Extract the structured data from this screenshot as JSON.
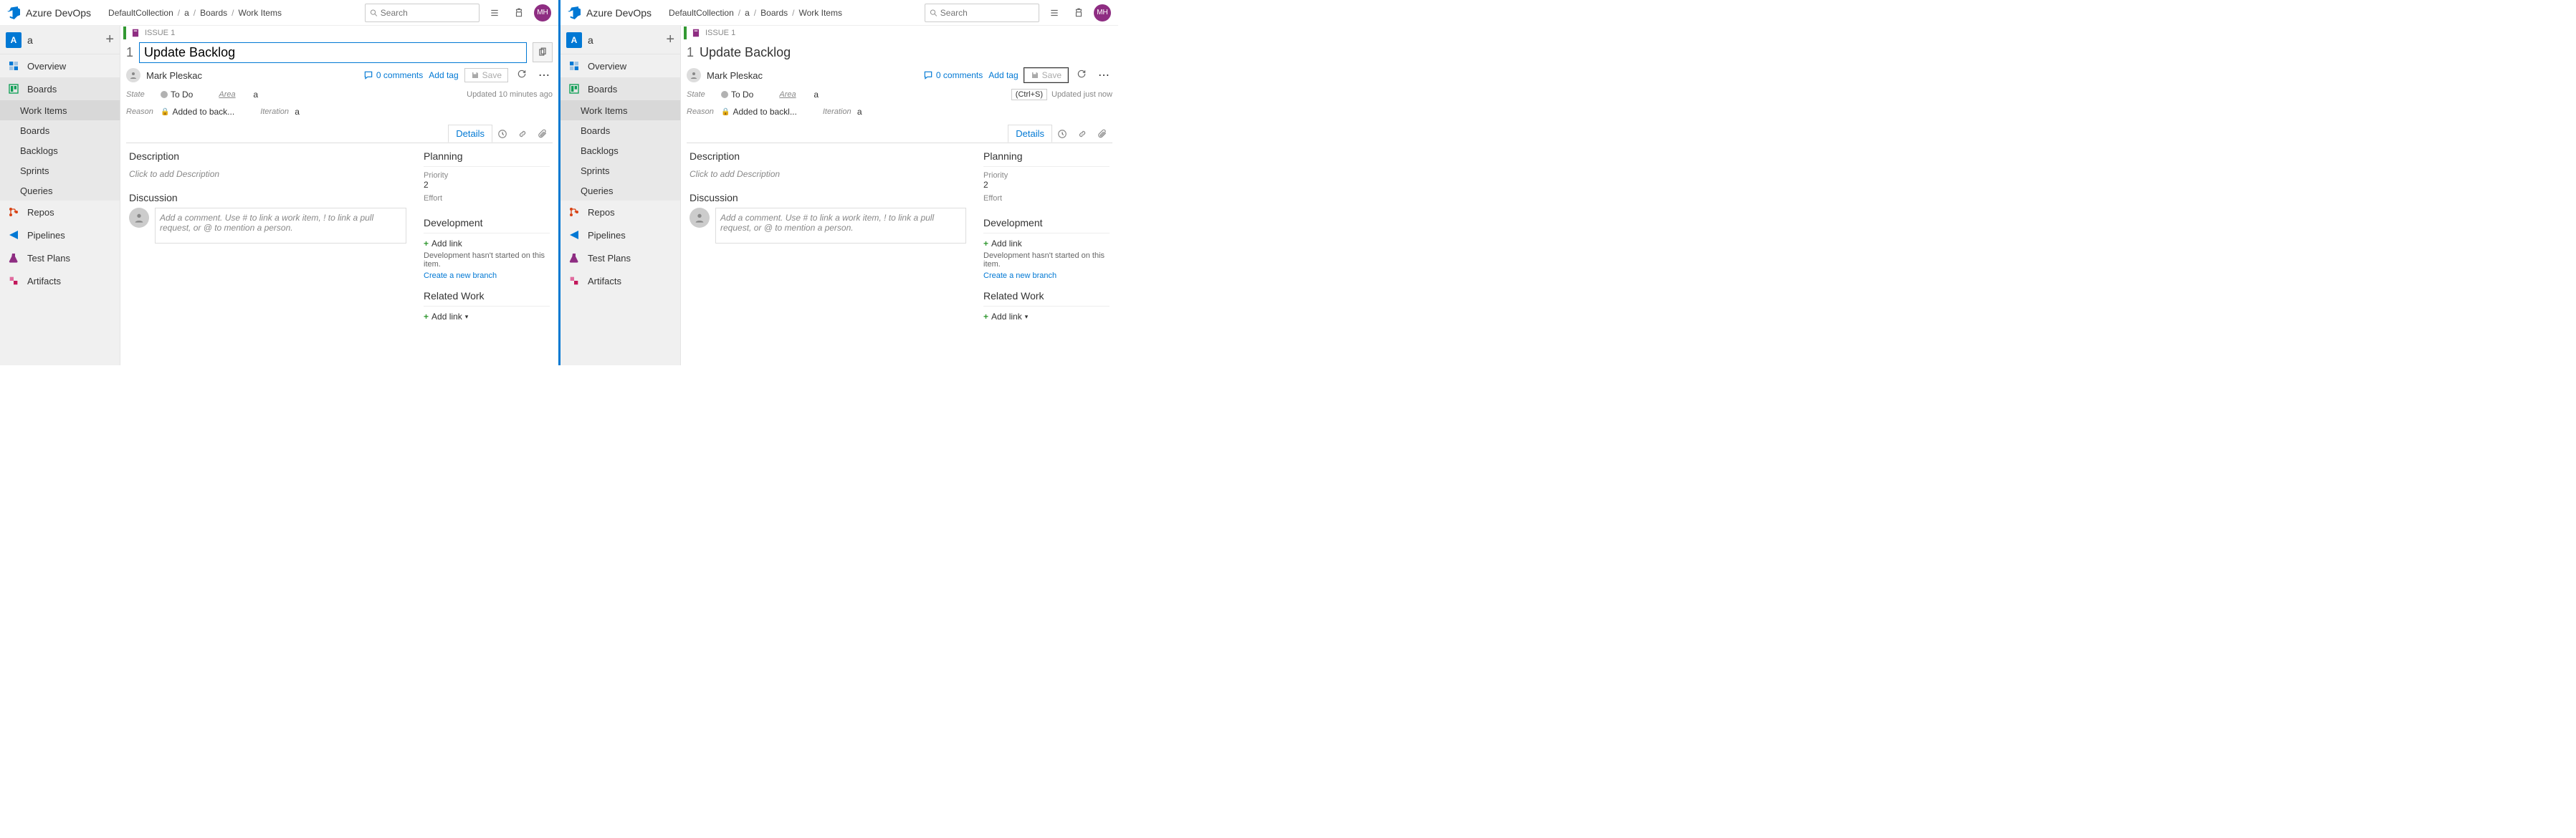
{
  "brand": "Azure DevOps",
  "breadcrumb": [
    "DefaultCollection",
    "a",
    "Boards",
    "Work Items"
  ],
  "search_placeholder": "Search",
  "avatar_initials": "MH",
  "project": {
    "badge": "A",
    "name": "a"
  },
  "nav": {
    "overview": "Overview",
    "boards": "Boards",
    "boards_children": [
      "Work Items",
      "Boards",
      "Backlogs",
      "Sprints",
      "Queries"
    ],
    "repos": "Repos",
    "pipelines": "Pipelines",
    "testplans": "Test Plans",
    "artifacts": "Artifacts"
  },
  "work_item": {
    "issue_label": "ISSUE 1",
    "id": "1",
    "title": "Update Backlog",
    "assignee": "Mark Pleskac",
    "comments": "0 comments",
    "add_tag": "Add tag",
    "save": "Save",
    "state_label": "State",
    "state_value": "To Do",
    "area_label": "Area",
    "area_value": "a",
    "reason_label": "Reason",
    "reason_value_left": "Added to back...",
    "reason_value_right": "Added to backl...",
    "iteration_label": "Iteration",
    "iteration_value": "a",
    "updated_left": "Updated 10 minutes ago",
    "updated_right": "Updated just now",
    "save_tooltip": "(Ctrl+S)"
  },
  "tabs": {
    "details": "Details"
  },
  "sections": {
    "description": "Description",
    "description_ph": "Click to add Description",
    "discussion": "Discussion",
    "discussion_ph": "Add a comment. Use # to link a work item, ! to link a pull request, or @ to mention a person.",
    "planning": "Planning",
    "priority_label": "Priority",
    "priority_value": "2",
    "effort_label": "Effort",
    "development": "Development",
    "addlink": "Add link",
    "dev_note": "Development hasn't started on this item.",
    "new_branch": "Create a new branch",
    "related": "Related Work",
    "addlink_dd": "Add link"
  }
}
